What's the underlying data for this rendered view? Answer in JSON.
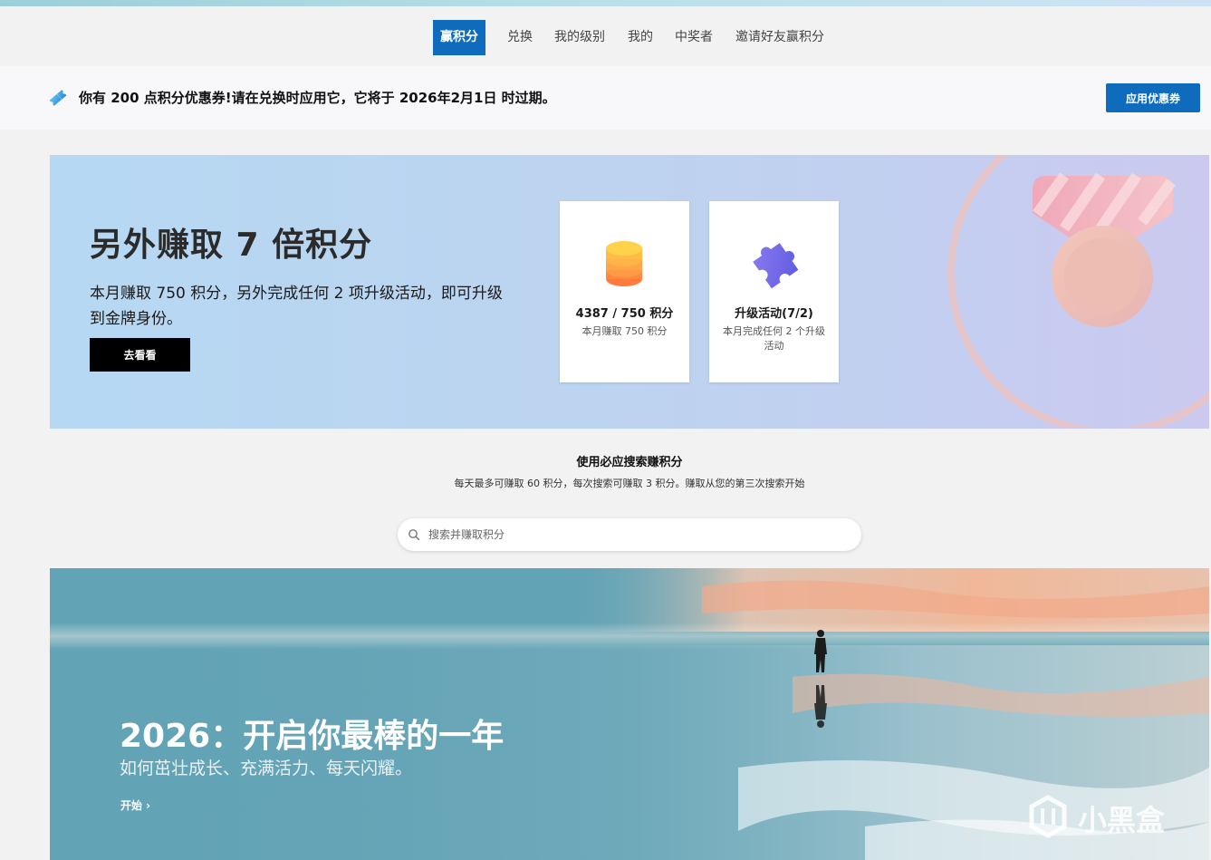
{
  "nav": {
    "items": [
      {
        "label": "赢积分",
        "active": true
      },
      {
        "label": "兑换"
      },
      {
        "label": "我的级别"
      },
      {
        "label": "我的"
      },
      {
        "label": "中奖者"
      },
      {
        "label": "邀请好友赢积分"
      }
    ]
  },
  "coupon": {
    "text": "你有 200 点积分优惠券!请在兑换时应用它，它将于 2026年2月1日 时过期。",
    "button": "应用优惠券",
    "icon": "ticket-icon"
  },
  "promo": {
    "title": "另外赚取 7 倍积分",
    "description": "本月赚取 750 积分，另外完成任何 2 项升级活动，即可升级到金牌身份。",
    "button": "去看看",
    "cards": [
      {
        "title": "4387 / 750 积分",
        "subtitle": "本月赚取 750 积分",
        "icon": "coin-stack-icon"
      },
      {
        "title": "升级活动(7/2)",
        "subtitle": "本月完成任何 2 个升级活动",
        "icon": "puzzle-piece-icon"
      }
    ],
    "medal_icon": "medal-icon"
  },
  "search": {
    "title": "使用必应搜索赚积分",
    "subtitle": "每天最多可赚取 60 积分，每次搜索可赚取 3 积分。赚取从您的第三次搜索开始",
    "placeholder": "搜索并赚取积分",
    "icon": "search-icon"
  },
  "hero": {
    "title": "2026：开启你最棒的一年",
    "subtitle": "如何茁壮成长、充满活力、每天闪耀。",
    "link": "开始 ›"
  },
  "watermark": {
    "text": "小黑盒",
    "icon": "xiaoheihe-logo-icon"
  },
  "colors": {
    "accent": "#0f6cbd",
    "black_button": "#000000"
  }
}
